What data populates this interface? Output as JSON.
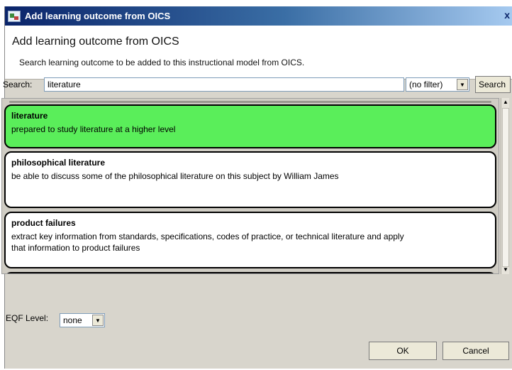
{
  "window": {
    "title": "Add learning outcome from OICS",
    "close_glyph": "x"
  },
  "header": {
    "title": "Add learning outcome from OICS",
    "description": "Search learning outcome to be added to this instructional model from OICS."
  },
  "search": {
    "label": "Search:",
    "value": "literature",
    "filter_value": "(no filter)",
    "button_label": "Search"
  },
  "outcomes": [
    {
      "title": "literature",
      "description": "prepared to study literature at a higher level",
      "selected": true
    },
    {
      "title": "philosophical literature",
      "description": "be able to discuss some of the philosophical literature on this subject by William James",
      "selected": false
    },
    {
      "title": "product failures",
      "description": "extract key information from standards, specifications, codes of practice, or technical literature and apply that information to product failures",
      "selected": false
    }
  ],
  "eqf": {
    "label": "EQF Level:",
    "value": "none"
  },
  "footer": {
    "ok_label": "OK",
    "cancel_label": "Cancel"
  },
  "colors": {
    "selected_item": "#5aee5a",
    "titlebar": "#0a246a"
  }
}
